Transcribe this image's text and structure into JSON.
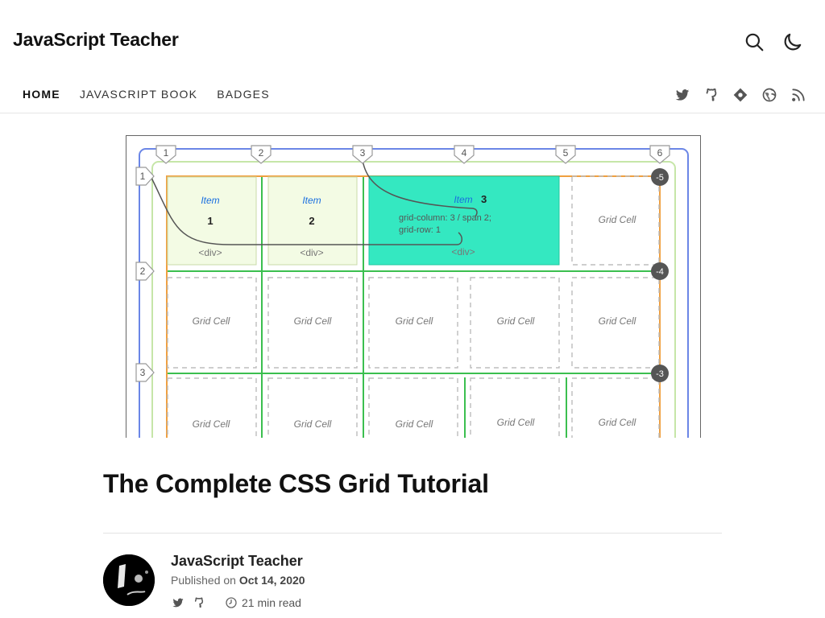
{
  "site": {
    "title": "JavaScript Teacher"
  },
  "header_icons": [
    "search-icon",
    "moon-icon"
  ],
  "nav": {
    "items": [
      {
        "label": "HOME",
        "active": true
      },
      {
        "label": "JAVASCRIPT BOOK",
        "active": false
      },
      {
        "label": "BADGES",
        "active": false
      }
    ]
  },
  "social_icons": [
    "twitter-icon",
    "github-icon",
    "diamond-icon",
    "globe-icon",
    "rss-icon"
  ],
  "hero": {
    "column_lines": [
      "1",
      "2",
      "3",
      "4",
      "5",
      "6"
    ],
    "row_lines": [
      "1",
      "2",
      "3"
    ],
    "negative_lines": [
      "-5",
      "-4",
      "-3"
    ],
    "item_word": "Item",
    "item_numbers": [
      "1",
      "2",
      "3"
    ],
    "div_tag": "<div>",
    "code_line_1": "grid-column: 3 / span 2;",
    "code_line_2": "grid-row: 1",
    "cell_label": "Grid Cell",
    "colors": {
      "item_fill": "#f3fbe4",
      "highlight_fill": "#34e8c1",
      "outer_blue": "#6b86e6",
      "green": "#3bbf4f",
      "orange": "#f0a040"
    }
  },
  "post": {
    "title": "The Complete CSS Grid Tutorial",
    "author": "JavaScript Teacher",
    "published_prefix": "Published on",
    "date": "Oct 14, 2020",
    "read_time": "21 min read"
  }
}
